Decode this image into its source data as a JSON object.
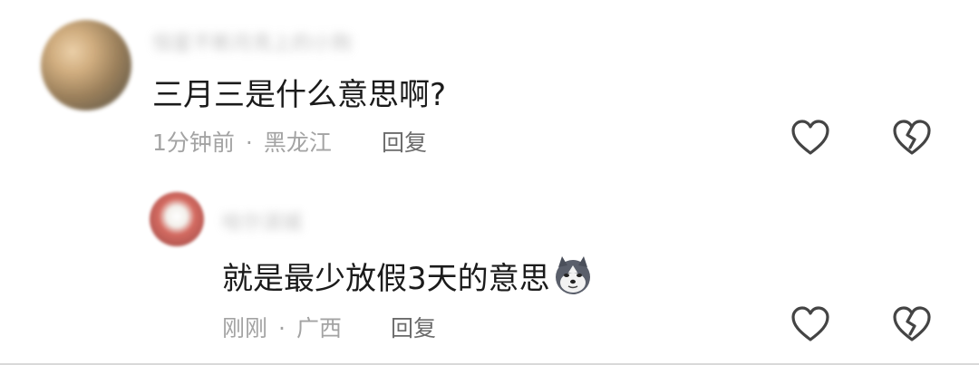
{
  "comments": [
    {
      "username": "恒星不断月亮上的小狗",
      "text": "三月三是什么意思啊?",
      "time": "1分钟前",
      "location": "黑龙江",
      "reply_label": "回复",
      "like_icon": "heart-outline-icon",
      "dislike_icon": "broken-heart-icon"
    },
    {
      "username": "哈尔滨城",
      "text": "就是最少放假3天的意思",
      "emoji": "doge-emoji",
      "time": "刚刚",
      "location": "广西",
      "reply_label": "回复",
      "like_icon": "heart-outline-icon",
      "dislike_icon": "broken-heart-icon"
    }
  ],
  "meta_separator": "·",
  "colors": {
    "text_primary": "#1b1b1b",
    "text_meta": "#a3a3a3",
    "text_reply": "#6b6b6b",
    "icon_stroke": "#444444"
  }
}
